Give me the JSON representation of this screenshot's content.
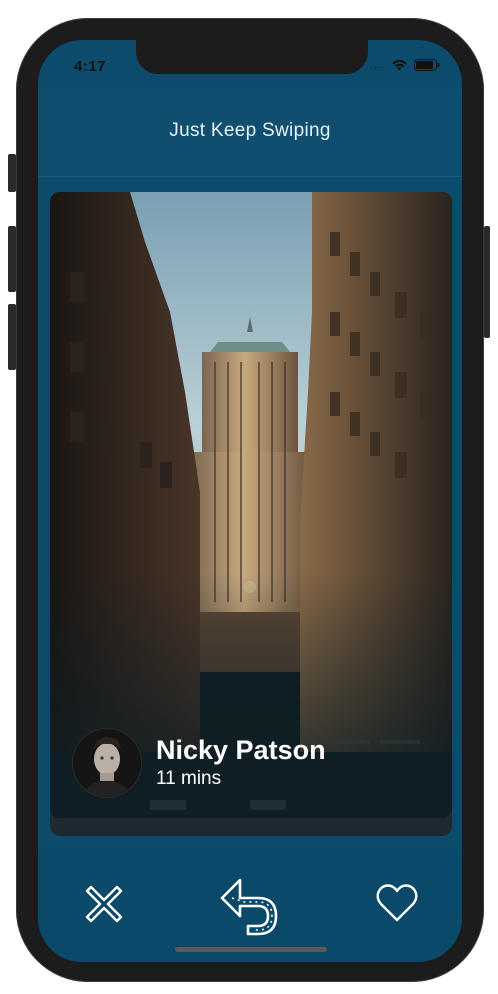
{
  "status_bar": {
    "time": "4:17"
  },
  "header": {
    "title": "Just Keep Swiping"
  },
  "card": {
    "name": "Nicky Patson",
    "time": "11 mins"
  },
  "actions": {
    "reject_icon": "close-icon",
    "undo_icon": "undo-icon",
    "like_icon": "heart-icon"
  },
  "colors": {
    "background": "#0d4b6c",
    "header": "#0f4e6f",
    "icon": "#ffffff"
  }
}
